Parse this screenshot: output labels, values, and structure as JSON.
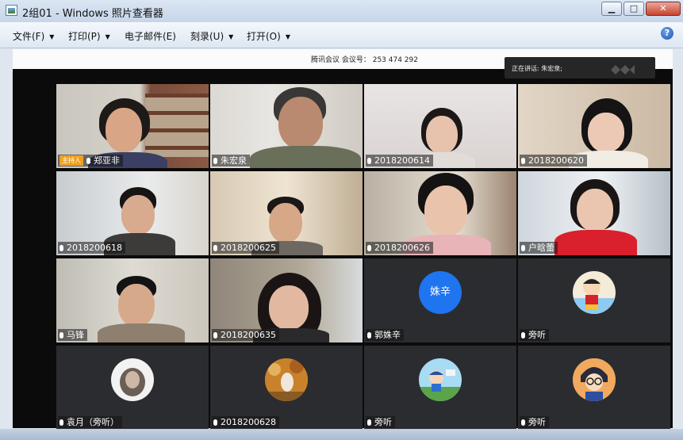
{
  "window": {
    "title": "2组01 - Windows 照片查看器",
    "minimize": "▁",
    "maximize": "□",
    "close": "✕"
  },
  "menu": {
    "items": [
      "文件(F)",
      "打印(P)",
      "电子邮件(E)",
      "刻录(U)",
      "打开(O)"
    ],
    "help": "?"
  },
  "meeting": {
    "info": "腾讯会议  会议号： 253 474 292",
    "speaker": "正在讲话: 朱宏泉;"
  },
  "host_badge": "主持人",
  "avatar_text": "姝辛",
  "tiles": [
    {
      "name": "郑亚非"
    },
    {
      "name": "朱宏泉"
    },
    {
      "name": "2018200614"
    },
    {
      "name": "2018200620"
    },
    {
      "name": "2018200618"
    },
    {
      "name": "2018200625"
    },
    {
      "name": "2018200626"
    },
    {
      "name": "户晗蕾"
    },
    {
      "name": "马锋"
    },
    {
      "name": "2018200635"
    },
    {
      "name": "郭姝辛"
    },
    {
      "name": "旁听"
    },
    {
      "name": "袁月（旁听）"
    },
    {
      "name": "2018200628"
    },
    {
      "name": "旁听"
    },
    {
      "name": "旁听"
    }
  ],
  "colors": {
    "avatar_blue": "#1f74f0",
    "host_badge": "#f0a020"
  }
}
